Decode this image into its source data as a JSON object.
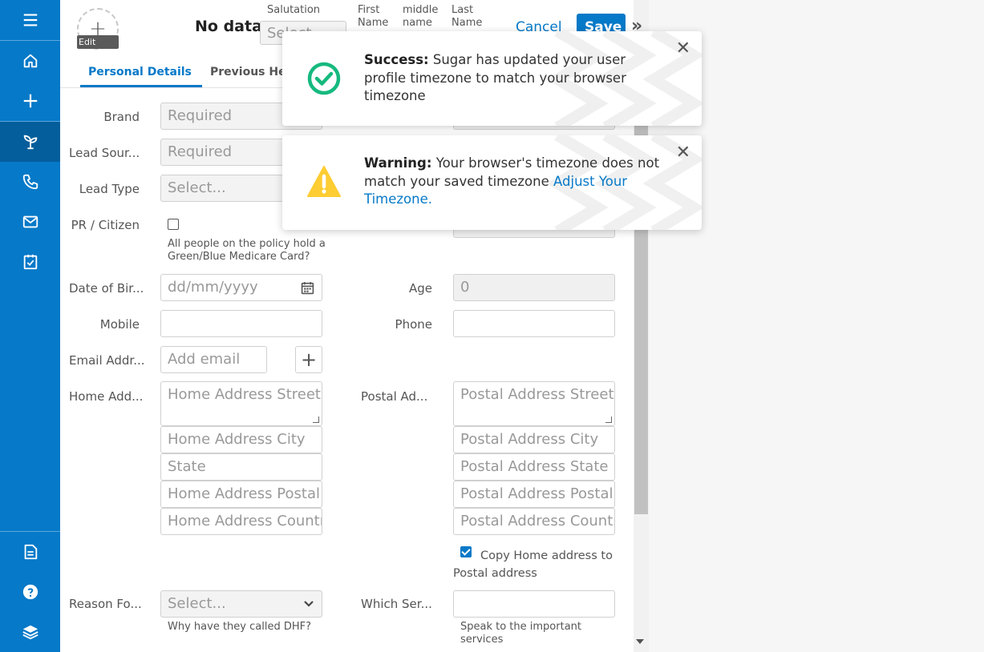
{
  "sidebar": {
    "items": [
      {
        "icon": "menu-icon"
      },
      {
        "icon": "home-icon"
      },
      {
        "icon": "plus-icon"
      },
      {
        "icon": "leads-plant-icon"
      },
      {
        "icon": "phone-icon"
      },
      {
        "icon": "mail-icon"
      },
      {
        "icon": "tasks-icon"
      },
      {
        "icon": "document-icon"
      },
      {
        "icon": "help-icon"
      },
      {
        "icon": "layers-icon"
      }
    ],
    "colors": {
      "bg": "#0679c8",
      "active": "#045e9c"
    }
  },
  "header": {
    "avatar_edit": "Edit",
    "name": "No data",
    "salutation_label": "Salutation",
    "salutation_value": "Select...",
    "first_name_label": "First Name",
    "middle_name_label": "middle name",
    "last_name_label": "Last Name",
    "cancel": "Cancel",
    "save": "Save"
  },
  "tabs": [
    {
      "label": "Personal Details",
      "active": true
    },
    {
      "label": "Previous Heal"
    }
  ],
  "form": {
    "brand": {
      "label": "Brand",
      "placeholder": "Required"
    },
    "lead_source": {
      "label": "Lead Sour...",
      "placeholder": "Required"
    },
    "lead_type": {
      "label": "Lead Type",
      "placeholder": "Select..."
    },
    "pr_citizen": {
      "label": "PR / Citizen",
      "help": "All people on the policy hold a Green/Blue Medicare Card?"
    },
    "dob": {
      "label": "Date of Bir...",
      "placeholder": "dd/mm/yyyy"
    },
    "age": {
      "label": "Age",
      "value": "0"
    },
    "mobile": {
      "label": "Mobile"
    },
    "phone": {
      "label": "Phone"
    },
    "email": {
      "label": "Email Addr...",
      "placeholder": "Add email"
    },
    "home_address": {
      "label": "Home Add...",
      "street": "Home Address Street",
      "city": "Home Address City",
      "state": "State",
      "postal": "Home Address Postal Code",
      "country": "Home Address Country"
    },
    "postal_address": {
      "label": "Postal Ad...",
      "street": "Postal Address Street",
      "city": "Postal Address City",
      "state": "Postal Address State",
      "postal": "Postal Address Postal Code",
      "country": "Postal Address Country"
    },
    "copy_address": {
      "label": "Copy Home address to Postal address",
      "checked": true
    },
    "reason": {
      "label": "Reason Fo...",
      "placeholder": "Select...",
      "help": "Why have they called DHF?"
    },
    "which_services": {
      "label": "Which Ser...",
      "help": "Speak to the important services"
    }
  },
  "toasts": [
    {
      "type": "success",
      "title": "Success:",
      "message": "Sugar has updated your user profile timezone to match your browser timezone",
      "color": "#16b97e"
    },
    {
      "type": "warning",
      "title": "Warning:",
      "message": "Your browser's timezone does not match your saved timezone",
      "link": "Adjust Your Timezone.",
      "color": "#fdcd33"
    }
  ]
}
